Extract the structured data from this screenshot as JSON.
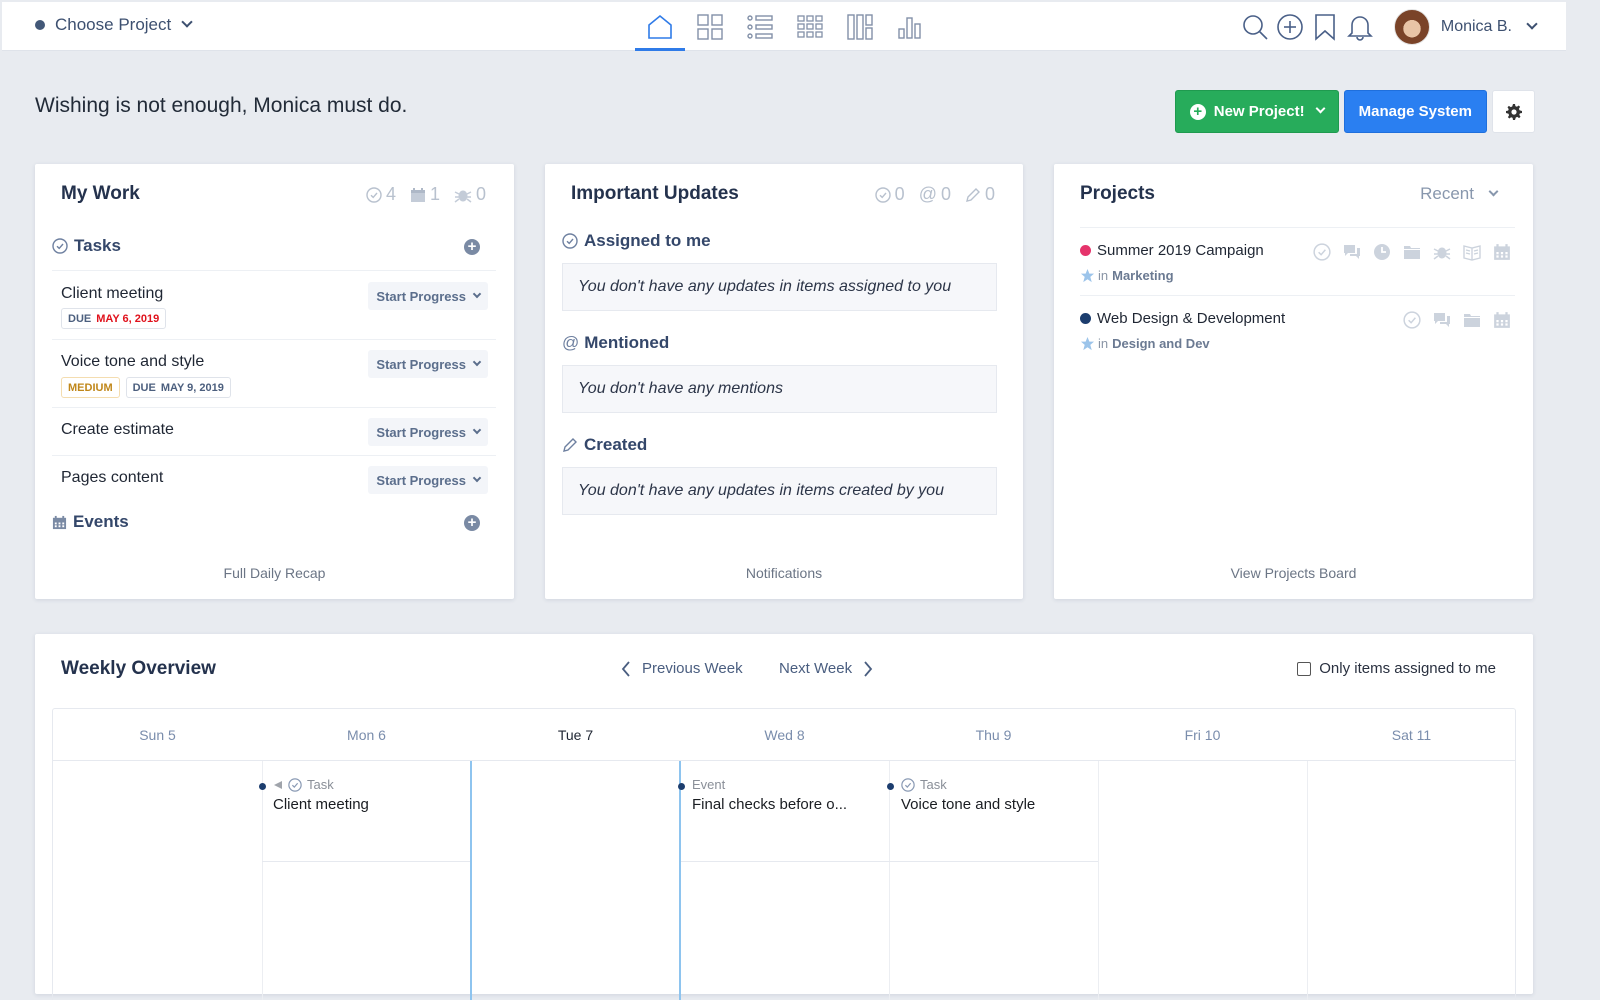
{
  "topbar": {
    "project_chooser": "Choose Project",
    "nav": [
      {
        "icon": "home-icon",
        "active": true
      },
      {
        "icon": "grid-4-icon",
        "active": false
      },
      {
        "icon": "list-icon",
        "active": false
      },
      {
        "icon": "grid-9-icon",
        "active": false
      },
      {
        "icon": "columns-icon",
        "active": false
      },
      {
        "icon": "bar-chart-icon",
        "active": false
      }
    ],
    "user_name": "Monica B."
  },
  "motto": "Wishing is not enough, Monica must do.",
  "actions": {
    "new_project": "New Project!",
    "manage_system": "Manage System"
  },
  "my_work": {
    "title": "My Work",
    "counts": {
      "tasks": "4",
      "events": "1",
      "bugs": "0"
    },
    "tasks_heading": "Tasks",
    "tasks": [
      {
        "name": "Client meeting",
        "action": "Start Progress",
        "due_label": "DUE",
        "due_date": "MAY 6, 2019",
        "overdue": true
      },
      {
        "name": "Voice tone and style",
        "action": "Start Progress",
        "priority": "MEDIUM",
        "due_label": "DUE",
        "due_date": "MAY 9, 2019",
        "overdue": false
      },
      {
        "name": "Create estimate",
        "action": "Start Progress"
      },
      {
        "name": "Pages content",
        "action": "Start Progress"
      }
    ],
    "events_heading": "Events",
    "footer": "Full Daily Recap"
  },
  "updates": {
    "title": "Important Updates",
    "counts": {
      "assigned": "0",
      "mentions": "0",
      "created": "0"
    },
    "sections": [
      {
        "heading": "Assigned to me",
        "empty": "You don't have any updates in items assigned to you"
      },
      {
        "heading": "Mentioned",
        "empty": "You don't have any mentions"
      },
      {
        "heading": "Created",
        "empty": "You don't have any updates in items created by you"
      }
    ],
    "footer": "Notifications"
  },
  "projects": {
    "title": "Projects",
    "filter": "Recent",
    "items": [
      {
        "name": "Summer 2019 Campaign",
        "color": "#e5336b",
        "in_label": "in",
        "group": "Marketing"
      },
      {
        "name": "Web Design & Development",
        "color": "#1c3d6e",
        "in_label": "in",
        "group": "Design and Dev"
      }
    ],
    "footer": "View Projects Board"
  },
  "weekly": {
    "title": "Weekly Overview",
    "prev": "Previous Week",
    "next": "Next Week",
    "only_mine": "Only items assigned to me",
    "only_mine_checked": false,
    "days": [
      "Sun 5",
      "Mon 6",
      "Tue 7",
      "Wed 8",
      "Thu 9",
      "Fri 10",
      "Sat 11"
    ],
    "today_index": 2,
    "events": [
      {
        "day": "Mon 6",
        "type": "Task",
        "title": "Client meeting",
        "continues_before": true
      },
      {
        "day": "Wed 8",
        "type": "Event",
        "title": "Final checks before o..."
      },
      {
        "day": "Thu 9",
        "type": "Task",
        "title": "Voice tone and style"
      }
    ]
  }
}
